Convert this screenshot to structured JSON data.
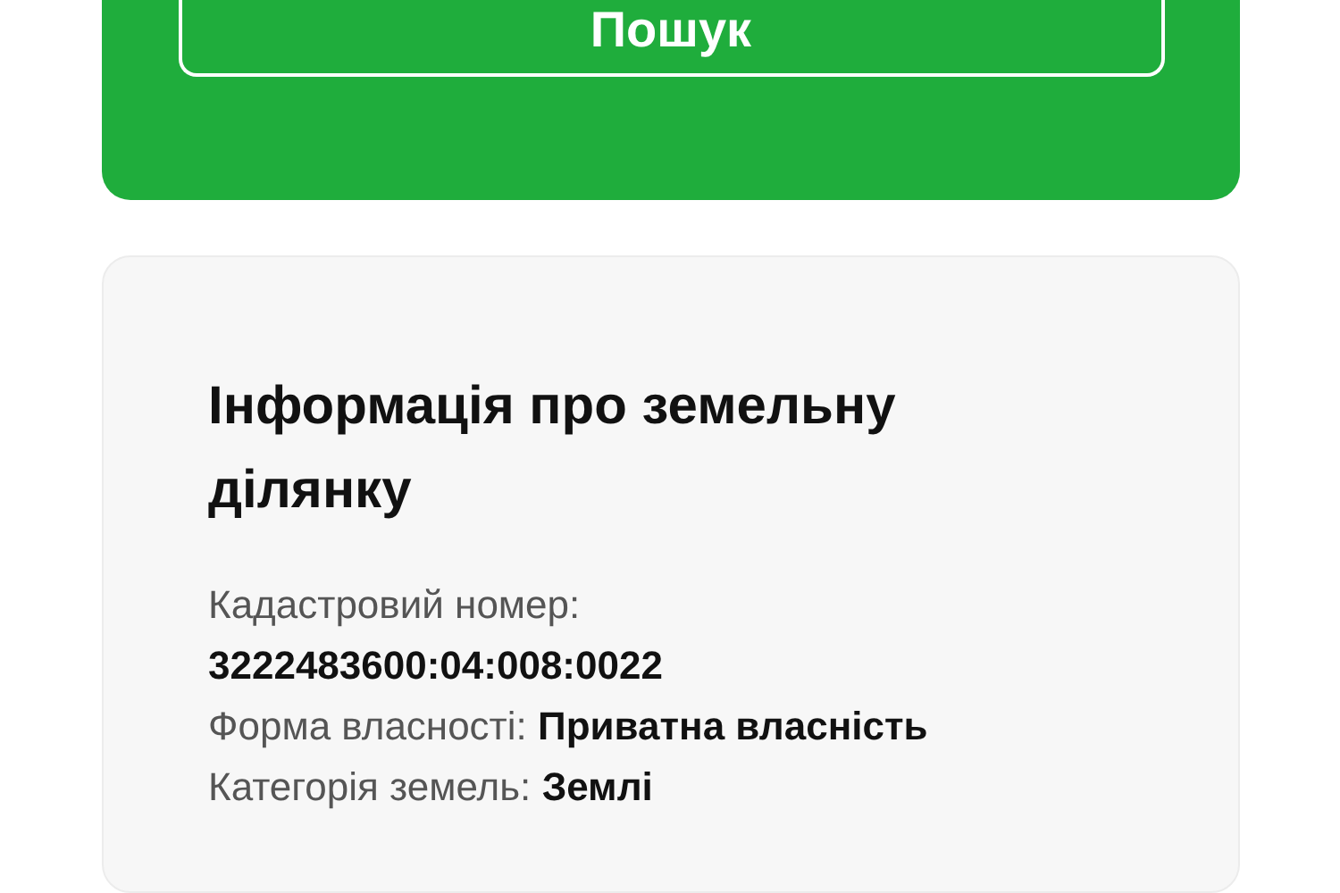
{
  "search_button": {
    "label": "Пошук"
  },
  "land_info": {
    "title": "Інформація про земельну ділянку",
    "fields": [
      {
        "label": "Кадастровий номер:",
        "value": "3222483600:04:008:0022",
        "kind": "stacked"
      },
      {
        "label": "Форма власності:",
        "value": "Приватна власність",
        "kind": "inline"
      },
      {
        "label": "Категорія земель:",
        "value": "Землі",
        "kind": "inline"
      }
    ]
  }
}
